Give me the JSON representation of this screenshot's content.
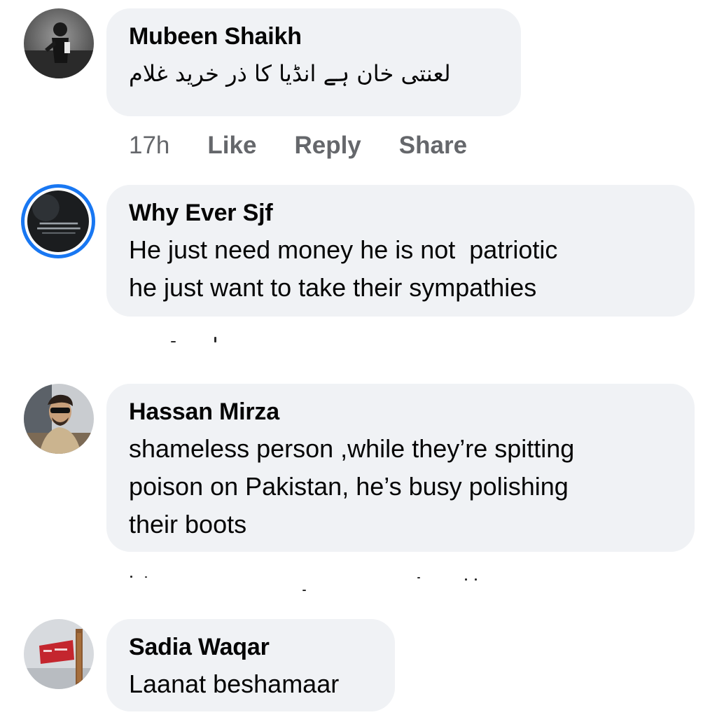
{
  "comments": [
    {
      "author": "Mubeen Shaikh",
      "text": "لعنتی خان ہے انڈیا کا ذر خرید غلام",
      "meta": {
        "time": "17h",
        "like": "Like",
        "reply": "Reply",
        "share": "Share"
      }
    },
    {
      "author": "Why Ever Sjf",
      "text": "He just need money he is not  patriotic\nhe just want to take their sympathies"
    },
    {
      "author": "Hassan Mirza",
      "text": "shameless person ,while they’re spitting\npoison on Pakistan, he’s busy polishing\ntheir boots"
    },
    {
      "author": "Sadia Waqar",
      "text": "Laanat beshamaar"
    }
  ]
}
